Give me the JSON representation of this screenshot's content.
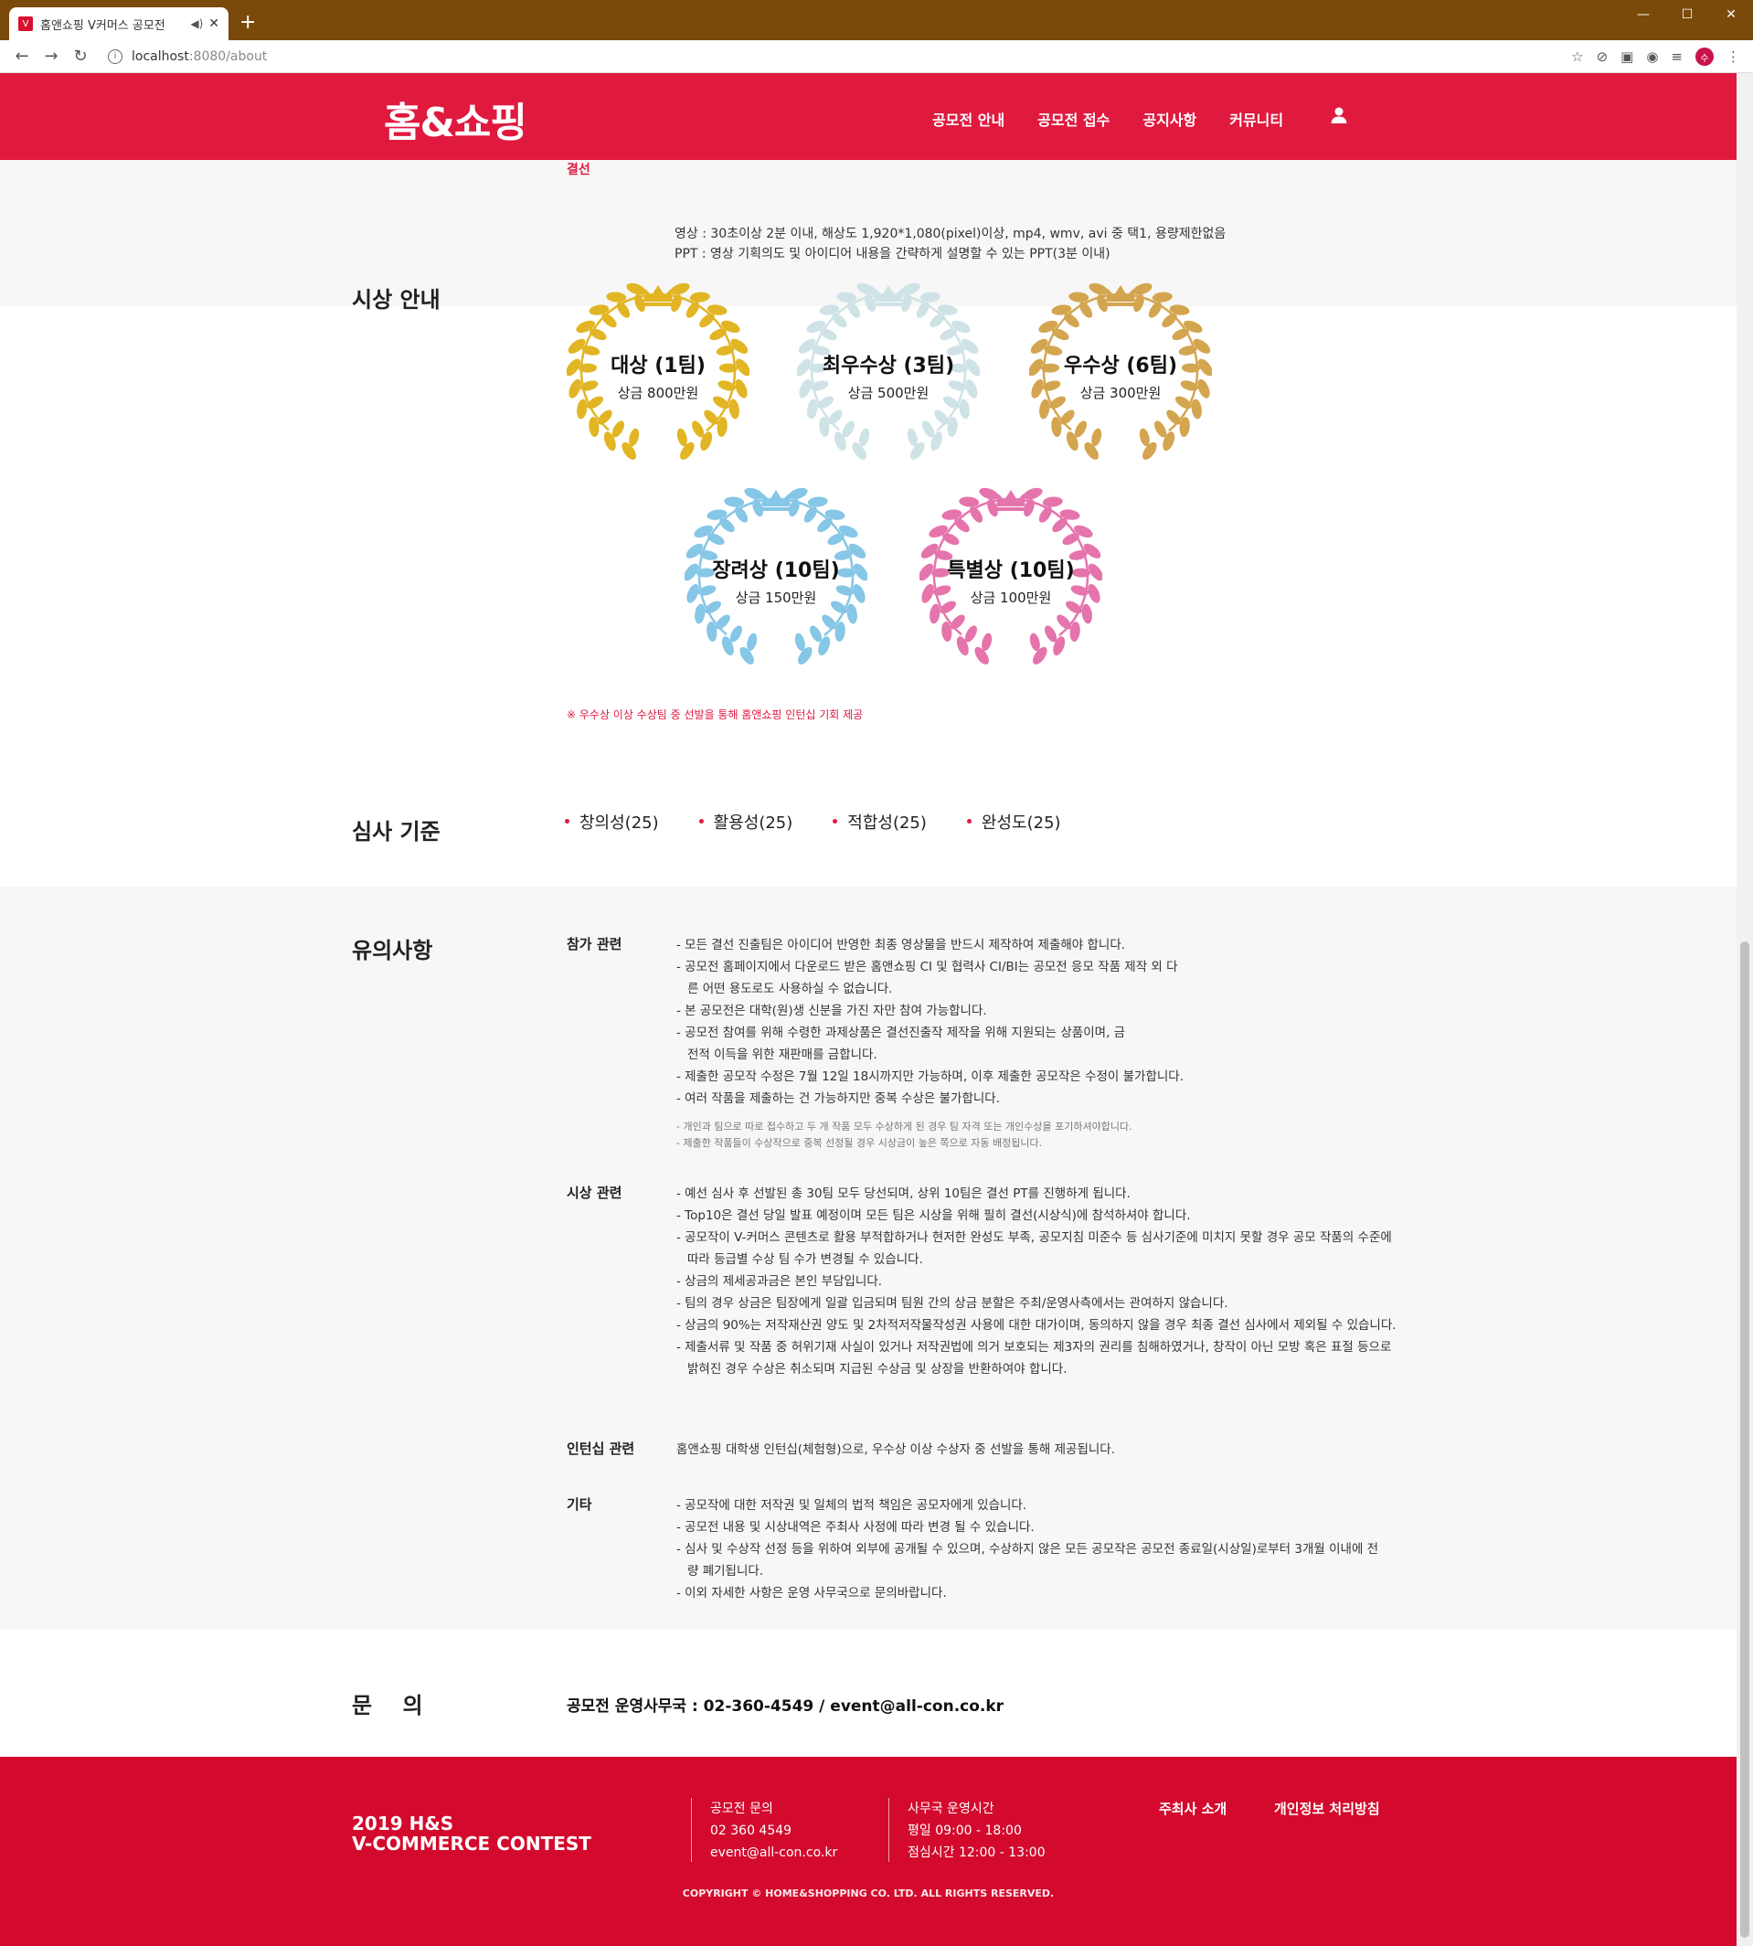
{
  "browser": {
    "tab_title": "홈앤쇼핑 V커머스 공모전",
    "url_host": "localhost",
    "url_path": ":8080/about"
  },
  "header": {
    "logo": "홈&쇼핑",
    "nav": [
      "공모전 안내",
      "공모전 접수",
      "공지사항",
      "커뮤니티"
    ]
  },
  "previous": {
    "label": "결선",
    "cut_line": "영상 : 30초이상 2분 이내, 해상도 1,920*1,080(pixel)이상, mp4, wmv, avi 중 택1, 용량제한없음",
    "line": "PPT : 영상 기획의도 및 아이디어 내용을 간략하게 설명할 수 있는 PPT(3분 이내)"
  },
  "awards": {
    "title": "시상 안내",
    "items": [
      {
        "name": "대상 (1팀)",
        "prize": "상금 800만원",
        "color": "#e2b524"
      },
      {
        "name": "최우수상 (3팀)",
        "prize": "상금 500만원",
        "color": "#cfe3e6"
      },
      {
        "name": "우수상 (6팀)",
        "prize": "상금 300만원",
        "color": "#d4a54f"
      },
      {
        "name": "장려상 (10팀)",
        "prize": "상금 150만원",
        "color": "#86c6e6"
      },
      {
        "name": "특별상 (10팀)",
        "prize": "상금 100만원",
        "color": "#e574ac"
      }
    ],
    "note": "※ 우수상 이상 수상팀 중 선발을 통해 홈앤쇼핑 인턴십 기회 제공"
  },
  "criteria": {
    "title": "심사 기준",
    "items": [
      "창의성(25)",
      "활용성(25)",
      "적합성(25)",
      "완성도(25)"
    ]
  },
  "notice": {
    "title": "유의사항",
    "groups": [
      {
        "title": "참가 관련",
        "items": [
          "- 모든 결선 진출팀은 아이디어 반영한 최종 영상물을 반드시 제작하여 제출해야 합니다.",
          "- 공모전 홈페이지에서 다운로드 받은 홈앤쇼핑 CI 및 협력사 CI/BI는 공모전 응모 작품 제작 외 다른 어떤 용도로도 사용하실 수 없습니다.",
          "- 본 공모전은 대학(원)생 신분을 가진 자만 참여 가능합니다.",
          "- 공모전 참여를 위해 수령한 과제상품은 결선진출작 제작을 위해 지원되는 상품이며, 금전적 이득을 위한 재판매를 금합니다.",
          "- 제출한 공모작 수정은 7월 12일 18시까지만 가능하며, 이후 제출한 공모작은 수정이 불가합니다.",
          "- 여러 작품을 제출하는 건 가능하지만 중복 수상은 불가합니다."
        ],
        "small": [
          "- 개인과 팀으로 따로 접수하고 두 개 작품 모두 수상하게 된 경우 팀 자격 또는 개인수상을 포기하셔야합니다.",
          "- 제출한 작품들이 수상작으로 중복 선정될 경우 시상금이 높은 쪽으로 자동 배정됩니다."
        ]
      },
      {
        "title": "시상 관련",
        "items": [
          "- 예선 심사 후 선발된 총 30팀 모두 당선되며, 상위 10팀은 결선 PT를 진행하게 됩니다.",
          "- Top10은 결선 당일 발표 예정이며 모든 팀은 시상을 위해 필히 결선(시상식)에 참석하셔야 합니다.",
          "- 공모작이 V-커머스 콘텐츠로 활용 부적합하거나 현저한 완성도 부족, 공모지침 미준수 등 심사기준에 미치지 못할 경우 공모 작품의 수준에 따라 등급별 수상 팀 수가 변경될 수 있습니다.",
          "- 상금의 제세공과금은 본인 부담입니다.",
          "- 팀의 경우 상금은 팀장에게 일괄 입금되며 팀원 간의 상금 분할은 주최/운영사측에서는 관여하지 않습니다.",
          "- 상금의 90%는 저작재산권 양도 및 2차적저작물작성권 사용에 대한 대가이며, 동의하지 않을 경우 최종 결선 심사에서 제외될 수 있습니다.",
          "- 제출서류 및 작품 중 허위기재 사실이 있거나 저작권법에 의거 보호되는 제3자의 권리를 침해하였거나, 창작이 아닌 모방 혹은 표절 등으로 밝혀진 경우 수상은 취소되며 지급된 수상금 및 상장을 반환하여야 합니다."
        ],
        "small": []
      },
      {
        "title": "인턴십 관련",
        "items": [
          "홈앤쇼핑 대학생 인턴십(체험형)으로, 우수상 이상 수상자 중 선발을 통해 제공됩니다."
        ],
        "small": []
      },
      {
        "title": "기타",
        "items": [
          "- 공모작에 대한 저작권 및 일체의 법적 책임은 공모자에게 있습니다.",
          "- 공모전 내용 및 시상내역은 주최사 사정에 따라 변경 될 수 있습니다.",
          "- 심사 및 수상작 선정 등을 위하여 외부에 공개될 수 있으며, 수상하지 않은 모든 공모작은 공모전 종료일(시상일)로부터 3개월 이내에 전량 폐기됩니다.",
          "- 이외 자세한 사항은 운영 사무국으로 문의바랍니다."
        ],
        "small": []
      }
    ]
  },
  "contact": {
    "title": "문    의",
    "text": "공모전 운영사무국 : 02-360-4549 / event@all-con.co.kr"
  },
  "footer": {
    "brand_line1": "2019 H&S",
    "brand_line2": "V-COMMERCE CONTEST",
    "col1": [
      "공모전 문의",
      "02 360 4549",
      "event@all-con.co.kr"
    ],
    "col2": [
      "사무국 운영시간",
      "평일 09:00 - 18:00",
      "점심시간 12:00 - 13:00"
    ],
    "links": [
      "주최사 소개",
      "개인정보 처리방침"
    ],
    "copyright": "COPYRIGHT © HOME&SHOPPING CO. LTD. ALL RIGHTS RESERVED."
  }
}
